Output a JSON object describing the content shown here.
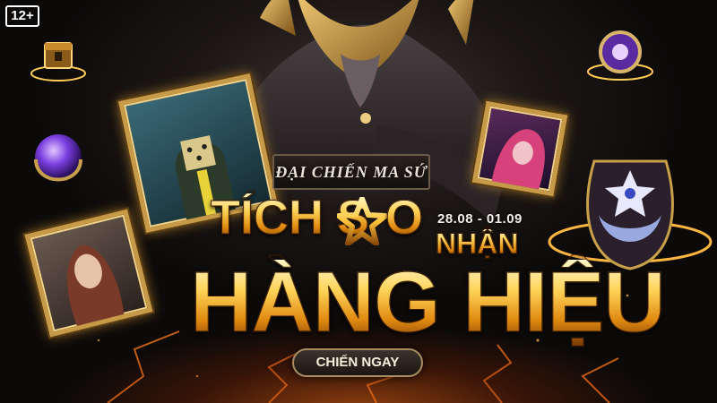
{
  "age_rating": "12+",
  "event_title": "ĐẠI CHIẾN MA SỨ",
  "headline": {
    "part1": "TÍCH S",
    "part2": "O",
    "small_word": "NHẬN",
    "line2": "HÀNG HIỆU"
  },
  "date_range": "28.08 - 01.09",
  "cta_label": "CHIẾN NGAY",
  "colors": {
    "gold": "#ffd45a",
    "frame_gold": "#c79a48",
    "ember": "#ff6e14",
    "purple_orb": "#7b3fe0"
  },
  "icons": [
    "treasure-chest-icon",
    "purple-orb-icon",
    "purple-ring-icon",
    "star-icon",
    "mystic-vase-icon"
  ]
}
